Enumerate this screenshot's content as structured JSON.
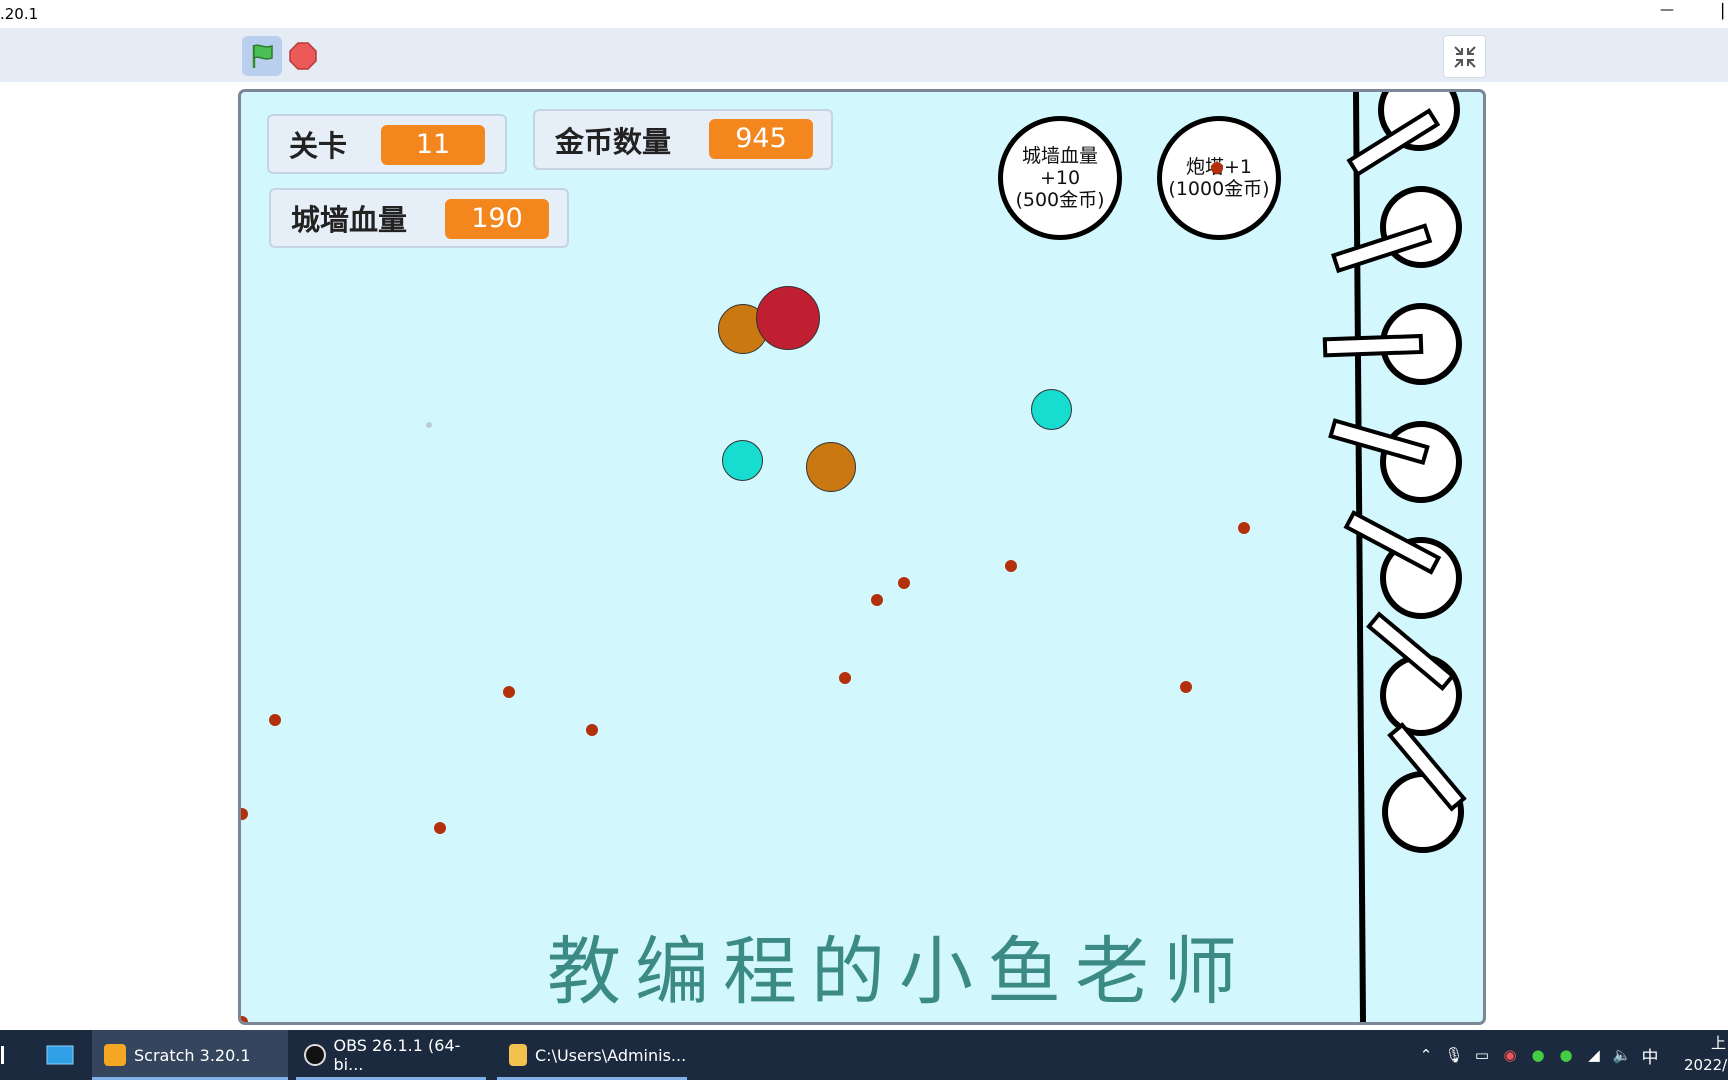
{
  "window": {
    "title": ".20.1",
    "minimize_glyph": "—",
    "edge_glyph": "▏"
  },
  "toolbar": {
    "green_flag": "green-flag-icon",
    "stop": "stop-icon",
    "fullscreen_exit": "exit-fullscreen-icon"
  },
  "monitors": {
    "level": {
      "label": "关卡",
      "value": "11"
    },
    "coins": {
      "label": "金币数量",
      "value": "945"
    },
    "wall_hp": {
      "label": "城墙血量",
      "value": "190"
    }
  },
  "shop": {
    "wall_upgrade": {
      "line1": "城墙血量+10",
      "line2": "(500金币)"
    },
    "turret_add": {
      "line1": "炮塔+1",
      "line2": "(1000金币)"
    }
  },
  "stage": {
    "background": "#d2f8fe",
    "enemy_colors": {
      "red": "#c01f32",
      "orange": "#c97812",
      "teal": "#17ddd0"
    },
    "bullet_color": "#b3300c",
    "turret_count": 7
  },
  "watermark": "教编程的小鱼老师",
  "taskbar": {
    "apps": [
      {
        "label": "Scratch 3.20.1",
        "icon": "scratch-icon"
      },
      {
        "label": "OBS 26.1.1 (64-bi...",
        "icon": "obs-icon"
      },
      {
        "label": "C:\\Users\\Adminis...",
        "icon": "folder-icon"
      }
    ],
    "ime": "中",
    "clock_top": "上",
    "clock_bottom": "2022/"
  }
}
